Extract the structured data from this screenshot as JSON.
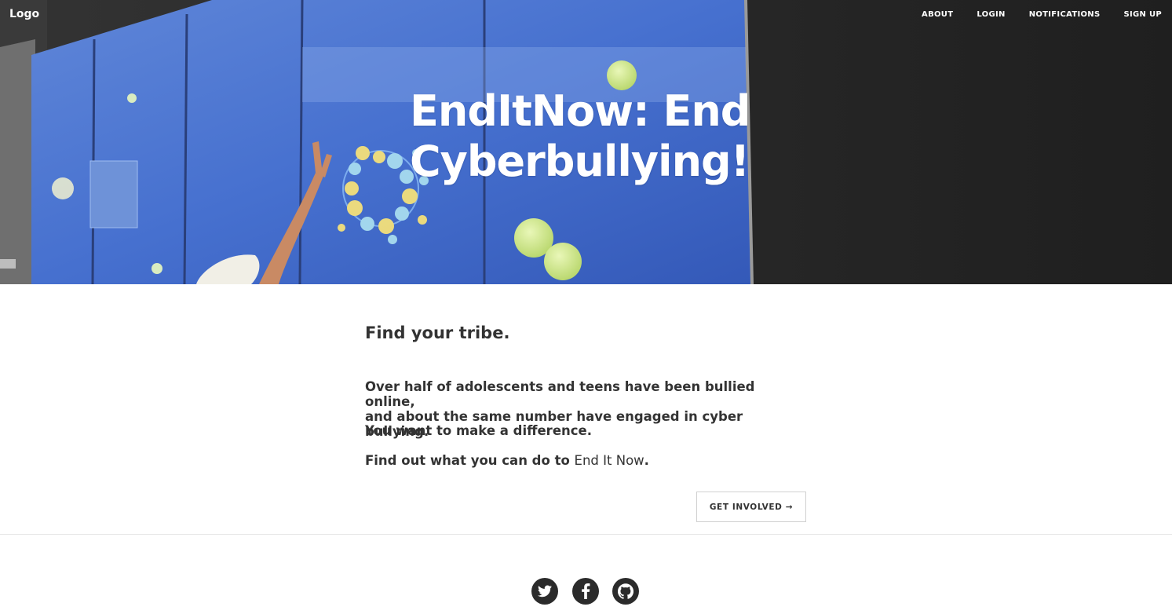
{
  "navbar": {
    "brand": "Logo",
    "links": [
      "ABOUT",
      "LOGIN",
      "NOTIFICATIONS",
      "SIGN UP"
    ]
  },
  "hero": {
    "title_line1": "EndItNow: End",
    "title_line2": "Cyberbullying!"
  },
  "content": {
    "tagline": "Find your tribe.",
    "para1_line1": "Over half of adolescents and teens have been bullied online,",
    "para1_line2": "and about the same number have engaged in cyber bullying.",
    "para2": "You want to make a difference.",
    "para3_prefix": "Find out what you can do to ",
    "para3_link": "End It Now",
    "para3_suffix": ".",
    "cta_button": "GET INVOLVED →"
  },
  "footer": {
    "social_icons": [
      "twitter-icon",
      "facebook-icon",
      "github-icon"
    ]
  },
  "colors": {
    "hero_screen_blue": "#3f66c8",
    "hero_dark_wall": "#262626",
    "text": "#333333",
    "social_bg": "#2b2b2b",
    "border": "#d0d0d0"
  }
}
